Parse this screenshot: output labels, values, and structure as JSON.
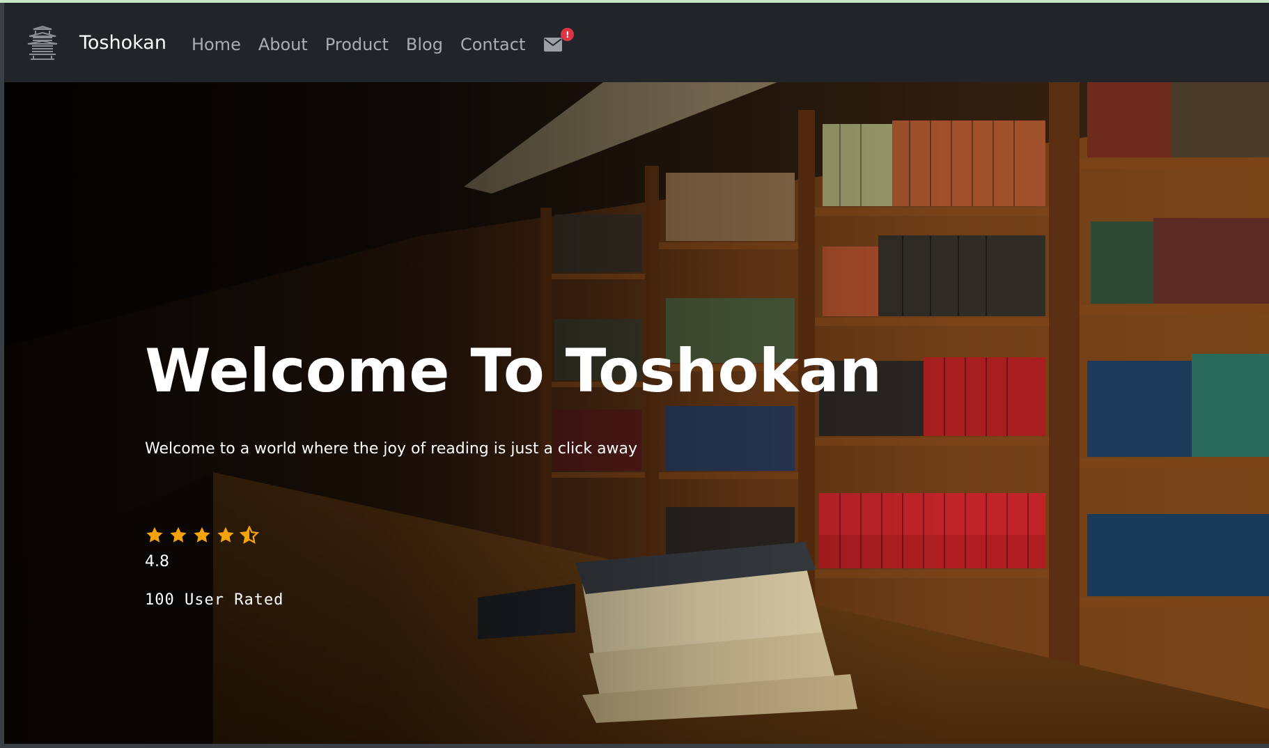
{
  "brand": {
    "name": "Toshokan",
    "logo_icon": "pagoda-icon"
  },
  "nav": {
    "items": [
      {
        "label": "Home"
      },
      {
        "label": "About"
      },
      {
        "label": "Product"
      },
      {
        "label": "Blog"
      },
      {
        "label": "Contact"
      }
    ],
    "mail_icon": "envelope-icon",
    "notification_badge": "!"
  },
  "hero": {
    "title": "Welcome To Toshokan",
    "subtitle": "Welcome to a world where the joy of reading is just a click away",
    "rating": {
      "stars": 4.5,
      "max_stars": 5,
      "value": "4.8",
      "rated_text": "100 User Rated"
    }
  },
  "colors": {
    "navbar_bg": "#212529",
    "star": "#f5a30a",
    "badge": "#dc3545",
    "text": "#ffffff"
  }
}
